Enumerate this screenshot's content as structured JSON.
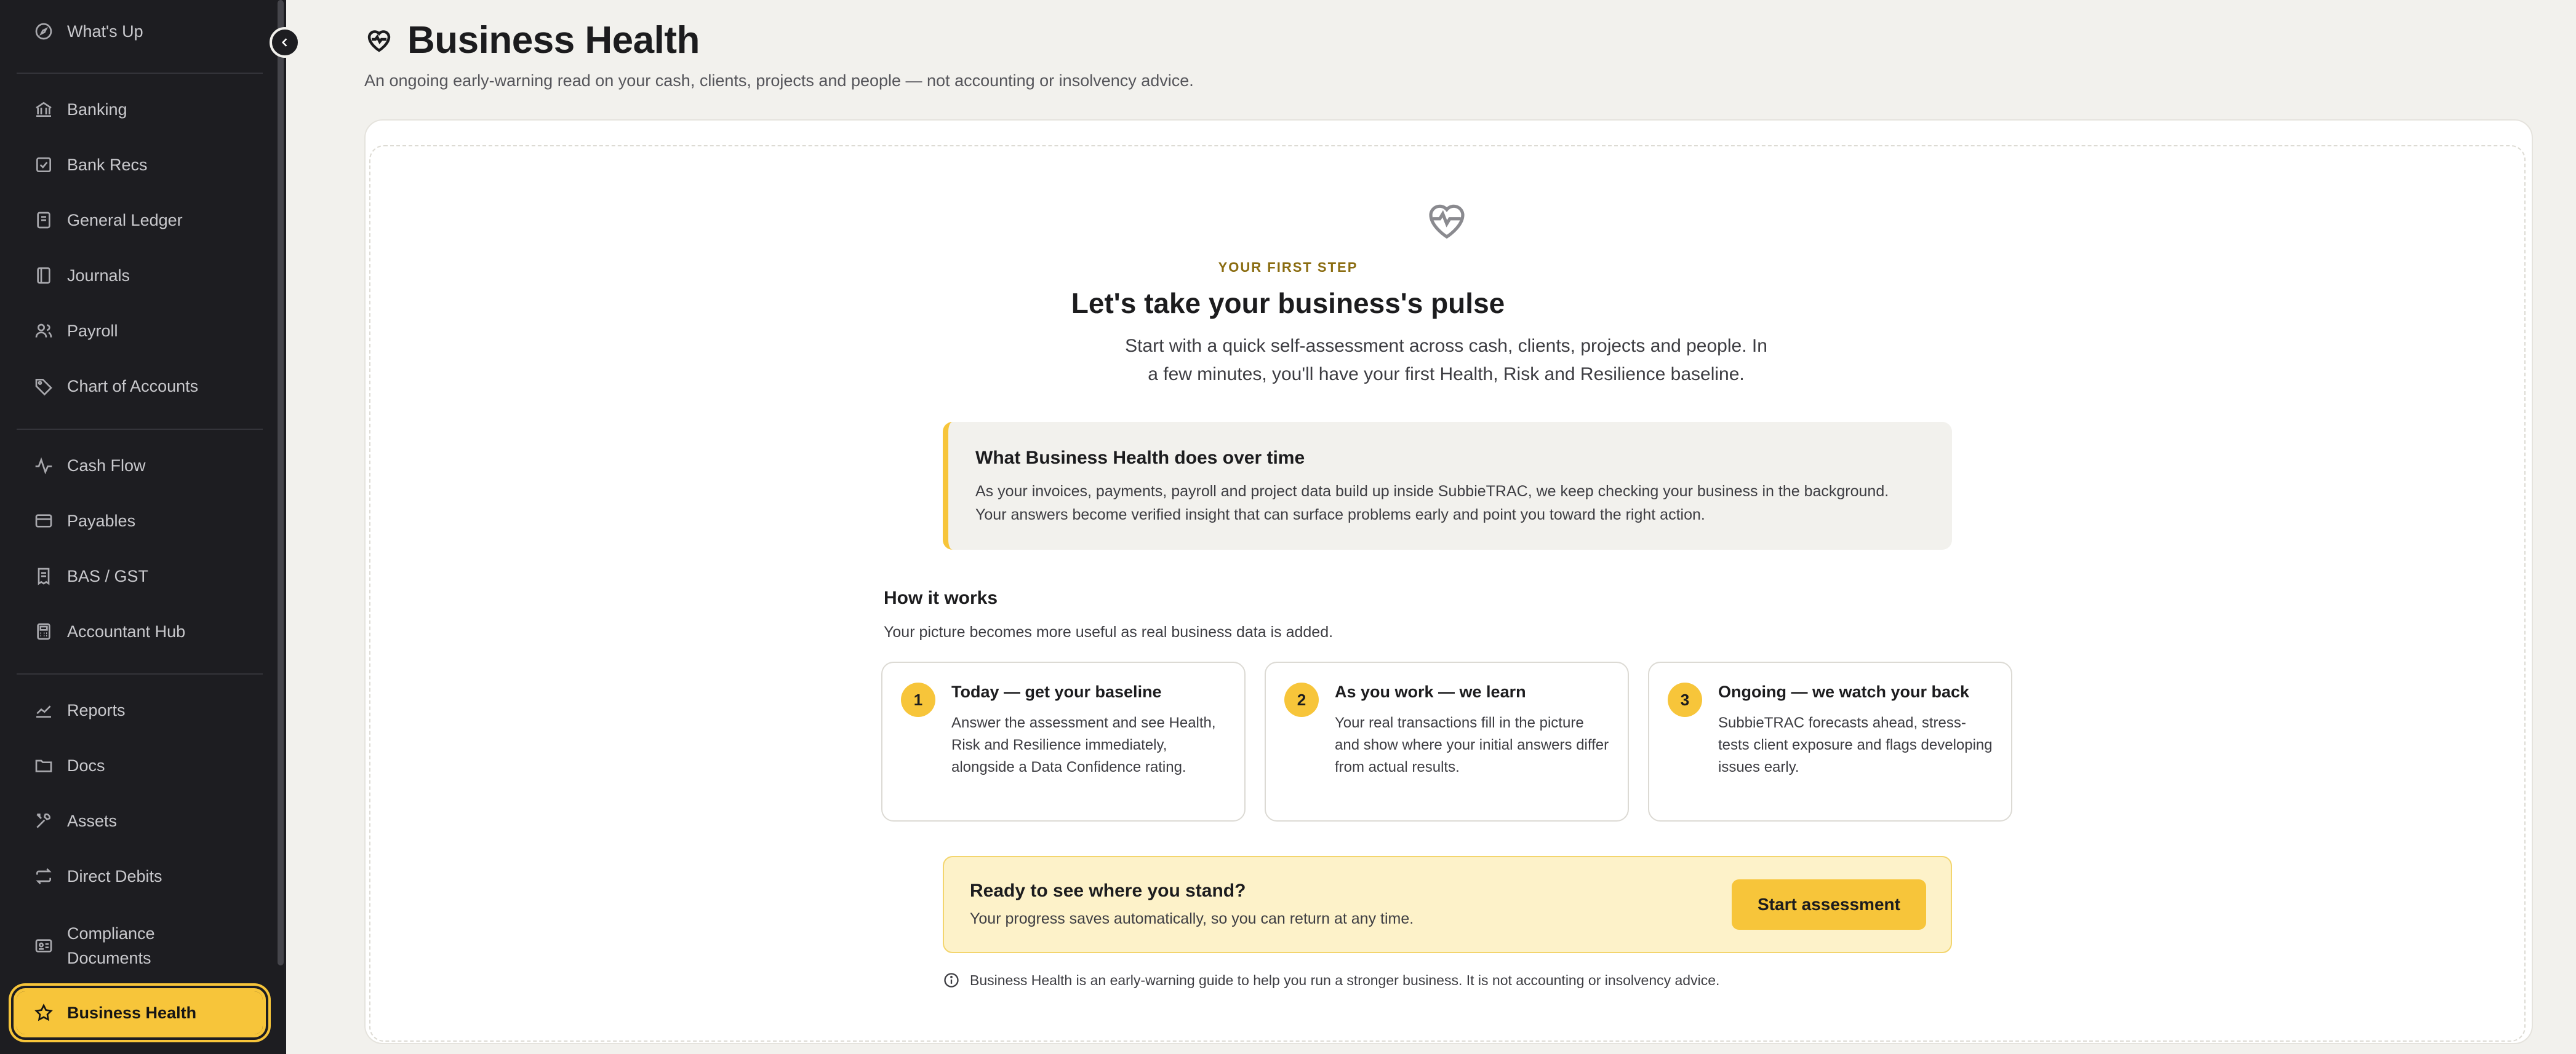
{
  "sidebar": {
    "items": [
      {
        "label": "What's Up",
        "icon": "compass-icon"
      },
      {
        "label": "Banking",
        "icon": "bank-icon"
      },
      {
        "label": "Bank Recs",
        "icon": "checkbox-icon"
      },
      {
        "label": "General Ledger",
        "icon": "ledger-icon"
      },
      {
        "label": "Journals",
        "icon": "journal-icon"
      },
      {
        "label": "Payroll",
        "icon": "users-icon"
      },
      {
        "label": "Chart of Accounts",
        "icon": "tag-icon"
      },
      {
        "label": "Cash Flow",
        "icon": "pulse-icon"
      },
      {
        "label": "Payables",
        "icon": "card-icon"
      },
      {
        "label": "BAS / GST",
        "icon": "receipt-icon"
      },
      {
        "label": "Accountant Hub",
        "icon": "calculator-icon"
      },
      {
        "label": "Reports",
        "icon": "chart-line-icon"
      },
      {
        "label": "Docs",
        "icon": "folder-icon"
      },
      {
        "label": "Assets",
        "icon": "tools-icon"
      },
      {
        "label": "Direct Debits",
        "icon": "repeat-icon"
      },
      {
        "label": "Compliance Documents",
        "icon": "id-card-icon"
      },
      {
        "label": "Business Health",
        "icon": "star-icon"
      }
    ],
    "active": "Business Health"
  },
  "header": {
    "title": "Business Health",
    "subtitle": "An ongoing early-warning read on your cash, clients, projects and people — not accounting or insolvency advice."
  },
  "hero": {
    "eyebrow": "YOUR FIRST STEP",
    "title": "Let's take your business's pulse",
    "text": "Start with a quick self-assessment across cash, clients, projects and people. In a few minutes, you'll have your first Health, Risk and Resilience baseline."
  },
  "info": {
    "title": "What Business Health does over time",
    "text": "As your invoices, payments, payroll and project data build up inside SubbieTRAC, we keep checking your business in the background. Your answers become verified insight that can surface problems early and point you toward the right action."
  },
  "how": {
    "title": "How it works",
    "subtitle": "Your picture becomes more useful as real business data is added.",
    "steps": [
      {
        "num": "1",
        "title": "Today — get your baseline",
        "text": "Answer the assessment and see Health, Risk and Resilience immediately, alongside a Data Confidence rating."
      },
      {
        "num": "2",
        "title": "As you work — we learn",
        "text": "Your real transactions fill in the picture and show where your initial answers differ from actual results."
      },
      {
        "num": "3",
        "title": "Ongoing — we watch your back",
        "text": "SubbieTRAC forecasts ahead, stress-tests client exposure and flags developing issues early."
      }
    ]
  },
  "cta": {
    "title": "Ready to see where you stand?",
    "text": "Your progress saves automatically, so you can return at any time.",
    "button": "Start assessment"
  },
  "disclaimer": "Business Health is an early-warning guide to help you run a stronger business. It is not accounting or insolvency advice.",
  "colors": {
    "accent": "#f7c53a",
    "sidebar_bg": "#1d1d21",
    "page_bg": "#f2f1ed"
  }
}
